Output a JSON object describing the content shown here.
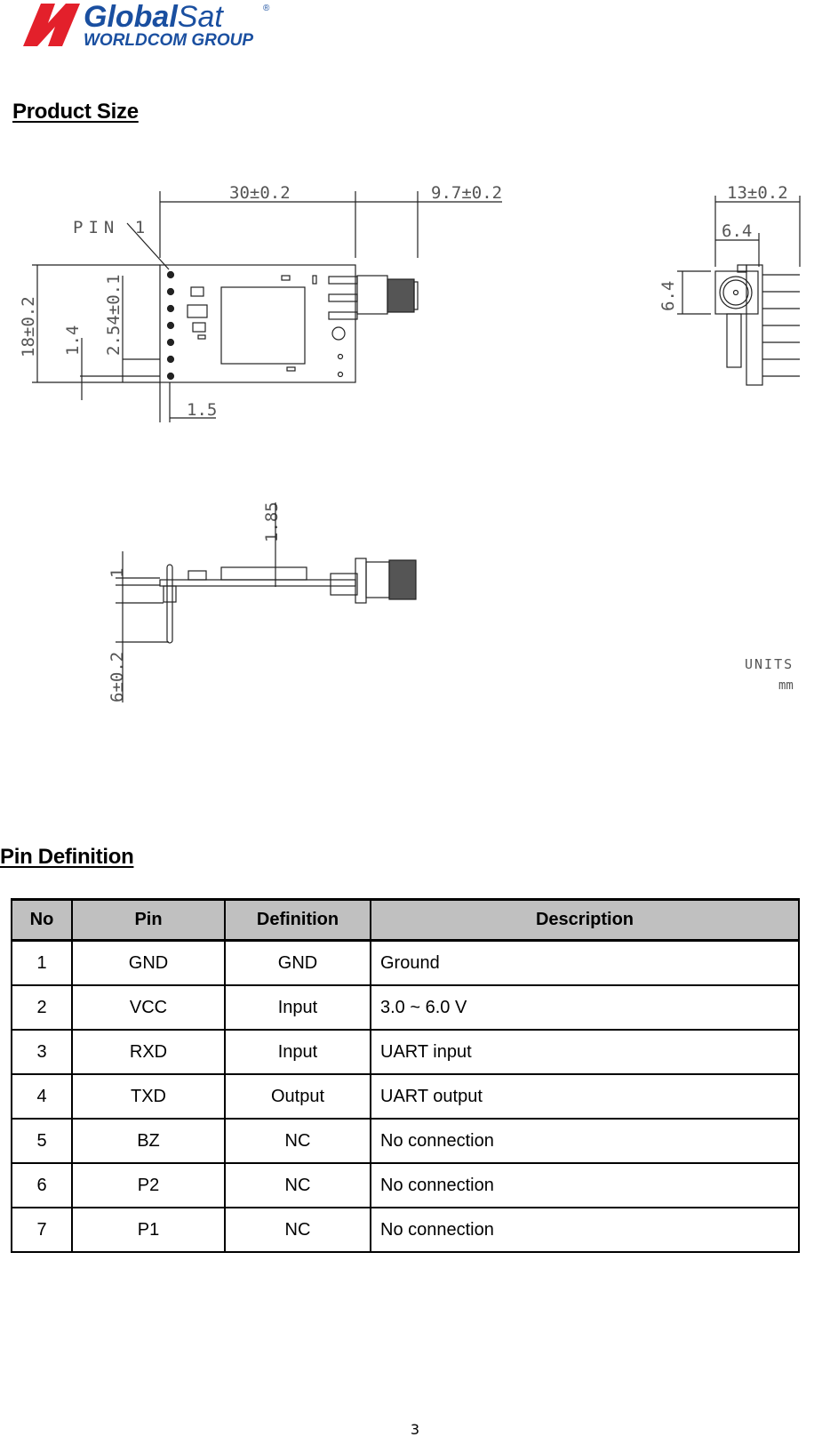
{
  "header": {
    "logo": {
      "brand": "GlobalSat",
      "brand_bold": "Global",
      "brand_light": "Sat",
      "registered": "®",
      "subtitle": "WORLDCOM GROUP",
      "brand_color": "#1a4fa0",
      "mark_color": "#e3202b"
    }
  },
  "product_size": {
    "title": "Product Size",
    "drawing": {
      "pin1_label": "PIN 1",
      "dims": {
        "length": "30±0.2",
        "antenna_length": "9.7±0.2",
        "width": "18±0.2",
        "pin_pitch": "2.54±0.1",
        "pin_offset": "1.4",
        "pin_edge": "1.5",
        "side_width": "13±0.2",
        "connector_w": "6.4",
        "connector_h": "6.4",
        "height": "1.85",
        "pcb_thickness": "1",
        "pin_length": "6±0.2"
      },
      "units_label": "UNITS",
      "units_value": "mm"
    }
  },
  "pin_definition": {
    "title": "Pin Definition",
    "columns": [
      "No",
      "Pin",
      "Definition",
      "Description"
    ],
    "rows": [
      {
        "no": "1",
        "pin": "GND",
        "definition": "GND",
        "description": "Ground"
      },
      {
        "no": "2",
        "pin": "VCC",
        "definition": "Input",
        "description": "3.0 ~ 6.0 V"
      },
      {
        "no": "3",
        "pin": "RXD",
        "definition": "Input",
        "description": "UART input"
      },
      {
        "no": "4",
        "pin": "TXD",
        "definition": "Output",
        "description": "UART output"
      },
      {
        "no": "5",
        "pin": "BZ",
        "definition": "NC",
        "description": "No connection"
      },
      {
        "no": "6",
        "pin": "P2",
        "definition": "NC",
        "description": "No connection"
      },
      {
        "no": "7",
        "pin": "P1",
        "definition": "NC",
        "description": "No connection"
      }
    ]
  },
  "footer": {
    "page_number": "3"
  }
}
